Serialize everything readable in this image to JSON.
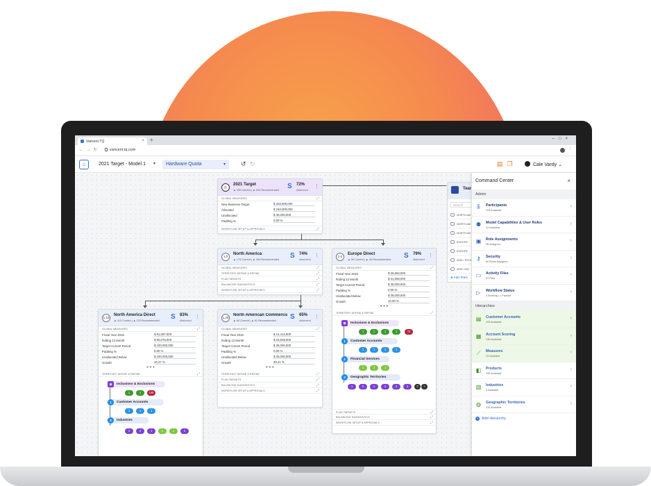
{
  "browser": {
    "tab_title": "Varicent TQ",
    "url": "varicent.tq.com"
  },
  "header": {
    "model_select": "2021 Target - Model 1",
    "quota_select": "Hardware Quota",
    "user_name": "Cale Vardy"
  },
  "cards": {
    "root": {
      "title": "2021 Target",
      "current": "220 Current",
      "recommended": "224 Recommended",
      "pct": "72%",
      "attainment": "Attainment",
      "section_global": "GLOBAL MEASURES",
      "rows": [
        {
          "label": "New Business Target",
          "value": "$ 233,000,000"
        },
        {
          "label": "Allocated",
          "value": "$ 153,000,000"
        },
        {
          "label": "Unallocated",
          "value": "$ 45,000,000"
        },
        {
          "label": "Padding %",
          "value": "0.00 %"
        }
      ],
      "section_workflow": "WORKFLOW SETUP & APPROVALS"
    },
    "na": {
      "num": "1.0",
      "title": "North America",
      "current": "173 Current",
      "recommended": "204 Recommended",
      "pct": "74%",
      "attainment": "Attainment",
      "sections": [
        "GLOBAL MEASURES",
        "TERRITORY DEFINE & REFINE",
        "PLAN TARGETS",
        "BALANCING DIAGNOSTICS",
        "WORKFLOW SETUP & APPROVALS"
      ]
    },
    "eu": {
      "num": "2.0",
      "title": "Europe Direct",
      "current": "99 Current",
      "recommended": "30 Recommended",
      "pct": "79%",
      "attainment": "Attainment",
      "section_global": "GLOBAL MEASURES",
      "rows": [
        {
          "label": "Fiscal Year 2018",
          "value": "$ 26,584,000"
        },
        {
          "label": "Rolling 12 Month",
          "value": "$ 31,658,000"
        },
        {
          "label": "Target Current Period",
          "value": "$ 35,000,000"
        },
        {
          "label": "Padding %",
          "value": "0.00 %"
        },
        {
          "label": "Unallocated Below",
          "value": "$ 35,000,000"
        },
        {
          "label": "Growth",
          "value": "10.00 %"
        }
      ],
      "section_territory": "TERRITORY DEFINE & REFINE",
      "tree": {
        "n1": "Inclusions & Exclusions",
        "n1_pills": [
          "1",
          "1",
          "1",
          "1",
          "72"
        ],
        "n2": "Customer Accounts",
        "n2_pills": [
          "1",
          "1",
          "1",
          "1"
        ],
        "n3": "Financial Services",
        "n3_pills": [
          "1",
          "1",
          "1"
        ],
        "n4": "Geographic Territories",
        "n4_pills": [
          "1",
          "2",
          "1",
          "2",
          "2",
          "2",
          "2",
          "+"
        ]
      },
      "bottom_sections": [
        "PLAN TARGETS",
        "BALANCING DIAGNOSTICS",
        "WORKFLOW SETUP & APPROVALS"
      ]
    },
    "nad": {
      "num": "1.10",
      "title": "North America Direct",
      "current": "113 Current",
      "recommended": "123 Recommended",
      "pct": "83%",
      "attainment": "Attainment",
      "section_global": "GLOBAL MEASURES",
      "rows": [
        {
          "label": "Fiscal Year 2018",
          "value": "$ 81,087,000"
        },
        {
          "label": "Rolling 12 Month",
          "value": "$ 90,078,000"
        },
        {
          "label": "Target Current Period",
          "value": "$ 100,000,000"
        },
        {
          "label": "Padding %",
          "value": "0.00 %"
        },
        {
          "label": "Unallocated Below",
          "value": "$ 100,000,000"
        },
        {
          "label": "Growth",
          "value": "10.27 %"
        }
      ],
      "section_territory": "TERRITORY DEFINE & REFINE",
      "tree": {
        "n1": "Inclusions & Exclusions",
        "n1_pills": [
          "1",
          "1",
          "145"
        ],
        "n2": "Customer Accounts",
        "n2_pills": [
          "1",
          "1",
          "1"
        ],
        "n3": "Industries",
        "n3_pills": [
          "1",
          "2",
          "1",
          "1",
          "1",
          "2"
        ]
      }
    },
    "nac": {
      "num": "1.20",
      "title": "North American Commercial",
      "current": "60 Current",
      "recommended": "81 Recommended",
      "pct": "65%",
      "attainment": "Attainment",
      "section_global": "GLOBAL MEASURES",
      "rows": [
        {
          "label": "Fiscal Year 2018",
          "value": "$ 12,414,000"
        },
        {
          "label": "Rolling 12 Month",
          "value": "$ 15,948,000"
        },
        {
          "label": "Target Current Period",
          "value": "$ 26,000,000"
        },
        {
          "label": "Padding %",
          "value": "0.00 %"
        },
        {
          "label": "Unallocated Below",
          "value": "$ 26,000,000"
        },
        {
          "label": "Growth",
          "value": "20.41 %"
        }
      ],
      "sections": [
        "TERRITORY DEFINE & REFINE",
        "PLAN TARGETS",
        "BALANCING DIAGNOSTICS",
        "WORKFLOW SETUP & APPROVALS"
      ]
    }
  },
  "team_panel": {
    "title": "Team",
    "search_placeholder": "Search",
    "items": [
      "NORTH AM",
      "NORTH AM",
      "NORTH AM",
      "EUROPE",
      "EUROPE",
      "APAC TECH",
      "APAC IND"
    ],
    "add_label": "Add Team"
  },
  "command_center": {
    "title": "Command Center",
    "admin_label": "Admin",
    "admin_items": [
      {
        "title": "Participants",
        "sub": "225 Available",
        "icon": "participants-icon"
      },
      {
        "title": "Model Capabilities & User Roles",
        "sub": "12 Available",
        "icon": "capabilities-icon"
      },
      {
        "title": "Role Assignments",
        "sub": "96 Assigned",
        "icon": "role-assignments-icon"
      },
      {
        "title": "Security",
        "sub": "96 Roles Assigned",
        "icon": "security-key-icon"
      },
      {
        "title": "Activity Files",
        "sub": "23 Files",
        "icon": "activity-files-icon"
      },
      {
        "title": "Workflow Status",
        "sub": "4 Working | 1 Paused",
        "icon": "workflow-status-icon"
      }
    ],
    "hier_label": "Hierarchies",
    "hier_items": [
      {
        "title": "Customer Accounts",
        "sub": "125 Available",
        "icon": "customer-accounts-icon",
        "hl": true
      },
      {
        "title": "Account Scoring",
        "sub": "235 Available",
        "icon": "account-scoring-icon",
        "hl": true
      },
      {
        "title": "Measures",
        "sub": "23 Available",
        "icon": "measures-icon",
        "hl": true
      },
      {
        "title": "Products",
        "sub": "150 Available",
        "icon": "products-icon",
        "hl": false
      },
      {
        "title": "Industries",
        "sub": "5 Available",
        "icon": "industries-icon",
        "hl": false
      },
      {
        "title": "Geographic Territories",
        "sub": "310 Available",
        "icon": "globe-icon",
        "hl": false
      }
    ],
    "add_hierarchy": "Add Hierarchy"
  }
}
